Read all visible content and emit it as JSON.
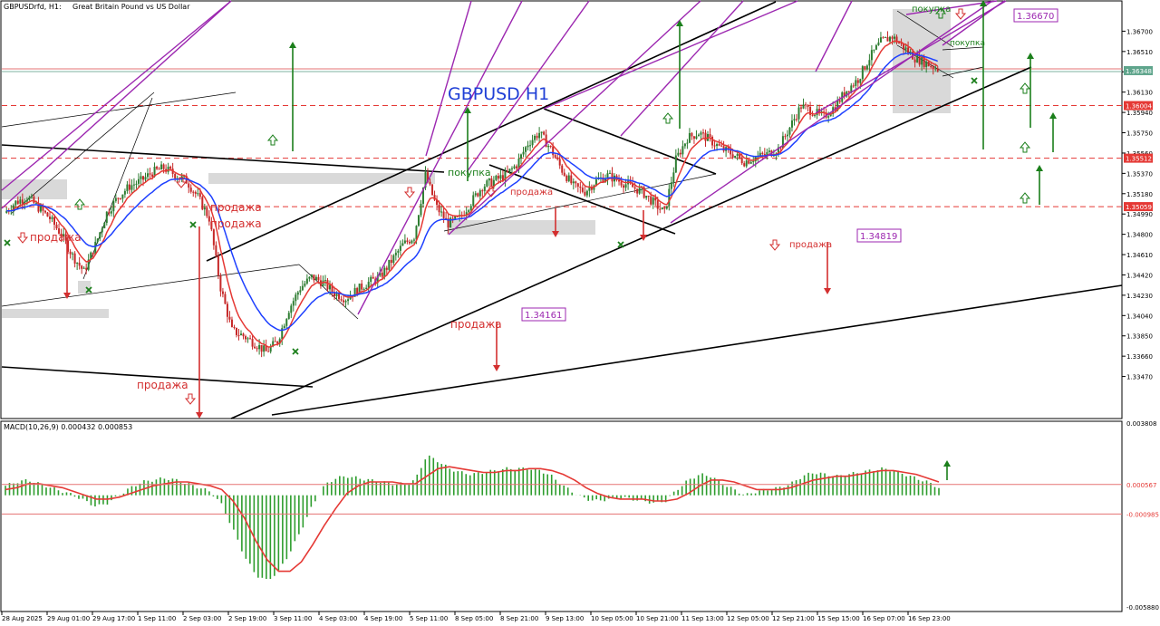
{
  "header": {
    "symbol": "GBPUSDrfd, H1:",
    "description": "Great Britain Pound vs US Dollar"
  },
  "big_title": "GBPUSD H1",
  "chart_data": {
    "type": "candlestick",
    "price_axis": {
      "ylim": [
        1.3328,
        1.3689
      ],
      "ticks": [
        "1.36700",
        "1.36510",
        "1.36320",
        "1.36130",
        "1.35940",
        "1.35750",
        "1.35560",
        "1.35370",
        "1.35180",
        "1.34990",
        "1.34800",
        "1.34610",
        "1.34420",
        "1.34230",
        "1.34040",
        "1.33850",
        "1.33660",
        "1.33470"
      ],
      "current_price": "1.36348",
      "hlines": [
        {
          "label": "1.36004",
          "value": 1.36004,
          "color": "#e53935"
        },
        {
          "label": "1.35512",
          "value": 1.35512,
          "color": "#e53935"
        },
        {
          "label": "1.35059",
          "value": 1.35059,
          "color": "#e53935"
        }
      ]
    },
    "time_axis": [
      "28 Aug 2025",
      "29 Aug 01:00",
      "29 Aug 17:00",
      "1 Sep 11:00",
      "2 Sep 03:00",
      "2 Sep 19:00",
      "3 Sep 11:00",
      "4 Sep 03:00",
      "4 Sep 19:00",
      "5 Sep 11:00",
      "8 Sep 05:00",
      "8 Sep 21:00",
      "9 Sep 13:00",
      "10 Sep 05:00",
      "10 Sep 21:00",
      "11 Sep 13:00",
      "12 Sep 05:00",
      "12 Sep 21:00",
      "15 Sep 15:00",
      "16 Sep 07:00",
      "16 Sep 23:00"
    ],
    "price_path": [
      1.35,
      1.351,
      1.3515,
      1.3505,
      1.3495,
      1.348,
      1.346,
      1.3445,
      1.347,
      1.35,
      1.3515,
      1.3525,
      1.353,
      1.3538,
      1.3542,
      1.3536,
      1.353,
      1.3515,
      1.3495,
      1.343,
      1.339,
      1.3385,
      1.3378,
      1.337,
      1.338,
      1.341,
      1.343,
      1.344,
      1.3435,
      1.3425,
      1.342,
      1.3428,
      1.3435,
      1.344,
      1.3455,
      1.347,
      1.3478,
      1.3535,
      1.3505,
      1.349,
      1.3495,
      1.351,
      1.3525,
      1.353,
      1.3535,
      1.3545,
      1.3565,
      1.3575,
      1.356,
      1.354,
      1.3525,
      1.352,
      1.353,
      1.3535,
      1.353,
      1.3525,
      1.352,
      1.351,
      1.35,
      1.355,
      1.357,
      1.3575,
      1.3568,
      1.356,
      1.3555,
      1.3548,
      1.3552,
      1.3555,
      1.356,
      1.358,
      1.36,
      1.3595,
      1.359,
      1.36,
      1.3615,
      1.3625,
      1.3645,
      1.366,
      1.3665,
      1.3655,
      1.3645,
      1.364,
      1.3635
    ],
    "price_labels": [
      {
        "text": "1.36670",
        "value": 1.3667
      },
      {
        "text": "1.34819",
        "value": 1.34819
      },
      {
        "text": "1.34161",
        "value": 1.34161
      }
    ],
    "signal_labels": {
      "sell": "продажа",
      "buy": "покупка"
    },
    "macd": {
      "title": "MACD(10,26,9) 0.000432 0.000853",
      "ylim": [
        -0.00588,
        0.0038
      ],
      "ticks": [
        "0.003808",
        "0.000567",
        "-0.000985",
        "-0.005880"
      ],
      "hist": [
        0.0005,
        0.0007,
        0.0008,
        0.0006,
        0.0004,
        0.0002,
        0.0,
        -0.0003,
        -0.0006,
        -0.0004,
        0.0,
        0.0004,
        0.0007,
        0.0008,
        0.0009,
        0.0008,
        0.0006,
        0.0004,
        0.0002,
        -0.0005,
        -0.0018,
        -0.0032,
        -0.0042,
        -0.0045,
        -0.004,
        -0.003,
        -0.0018,
        -0.0005,
        0.0005,
        0.0009,
        0.001,
        0.0009,
        0.0008,
        0.0007,
        0.0006,
        0.0006,
        0.0008,
        0.0021,
        0.0018,
        0.0014,
        0.0012,
        0.0011,
        0.0012,
        0.0013,
        0.0014,
        0.0014,
        0.0014,
        0.0013,
        0.001,
        0.0005,
        0.0001,
        -0.0002,
        -0.0003,
        -0.0002,
        -0.0001,
        -0.0002,
        -0.0003,
        -0.0004,
        -0.0003,
        0.0003,
        0.0008,
        0.0011,
        0.001,
        0.0006,
        0.0003,
        0.0,
        0.0002,
        0.0003,
        0.0004,
        0.0006,
        0.001,
        0.0012,
        0.0011,
        0.001,
        0.0011,
        0.0012,
        0.0013,
        0.0014,
        0.0013,
        0.0011,
        0.0009,
        0.0007,
        0.0004
      ],
      "signal": [
        0.0003,
        0.0004,
        0.0006,
        0.0006,
        0.0005,
        0.0004,
        0.0002,
        0.0,
        -0.0002,
        -0.0002,
        -0.0001,
        0.0001,
        0.0003,
        0.0005,
        0.0006,
        0.0007,
        0.0007,
        0.0006,
        0.0005,
        0.0003,
        -0.0003,
        -0.0012,
        -0.0024,
        -0.0034,
        -0.004,
        -0.004,
        -0.0035,
        -0.0026,
        -0.0016,
        -0.0007,
        0.0001,
        0.0005,
        0.0007,
        0.0007,
        0.0007,
        0.0006,
        0.0006,
        0.001,
        0.0014,
        0.0015,
        0.0014,
        0.0013,
        0.0012,
        0.0012,
        0.0013,
        0.0013,
        0.0014,
        0.0014,
        0.0013,
        0.0011,
        0.0008,
        0.0004,
        0.0001,
        -0.0001,
        -0.0002,
        -0.0002,
        -0.0002,
        -0.0003,
        -0.0003,
        -0.0002,
        0.0001,
        0.0005,
        0.0008,
        0.0008,
        0.0007,
        0.0005,
        0.0003,
        0.0003,
        0.0003,
        0.0004,
        0.0006,
        0.0008,
        0.0009,
        0.001,
        0.001,
        0.0011,
        0.0012,
        0.0013,
        0.0013,
        0.0012,
        0.0011,
        0.0009,
        0.0007
      ]
    }
  },
  "colors": {
    "bull": "#2e7d32",
    "bear": "#c62828",
    "ma_fast": "#e53935",
    "ma_slow": "#1e40ff",
    "channel": "#000000",
    "level": "#9c27b0",
    "sell_arrow": "#d32f2f",
    "buy_arrow": "#1b7f1b",
    "zone": "#cfcfcf"
  }
}
